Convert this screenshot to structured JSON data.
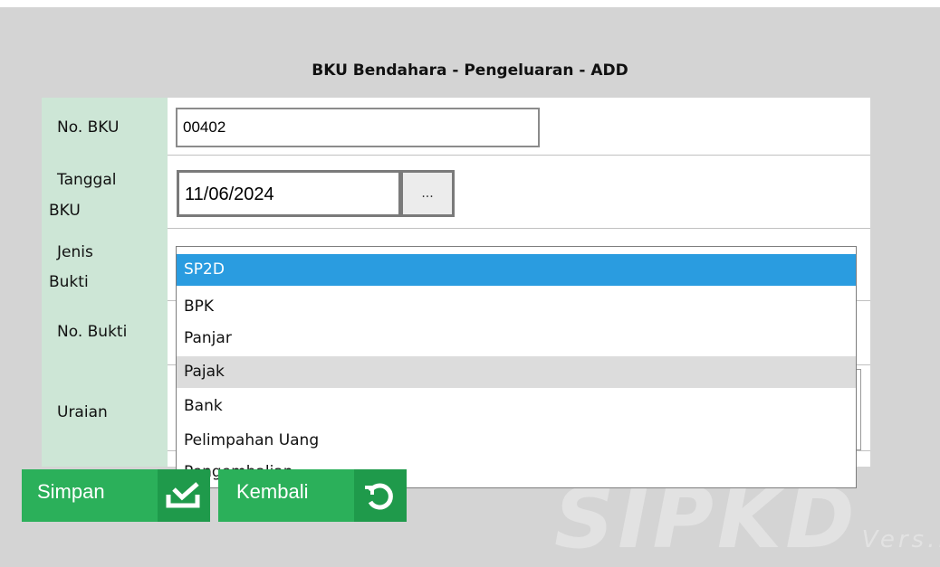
{
  "form": {
    "title": "BKU Bendahara - Pengeluaran - ADD",
    "no_bku_label": "No. BKU",
    "no_bku_value": "00402",
    "tanggal_label_line1": "Tanggal",
    "tanggal_label_line2": "BKU",
    "tanggal_value": "11/06/2024",
    "date_picker_label": "...",
    "jenis_label_line1": "Jenis",
    "jenis_label_line2": "Bukti",
    "no_bukti_label": "No. Bukti",
    "uraian_label": "Uraian"
  },
  "dropdown": {
    "options": [
      "SP2D",
      "BPK",
      "Panjar",
      "Pajak",
      "Bank",
      "Pelimpahan Uang",
      "Pengembalian"
    ],
    "selected": "SP2D",
    "hovered": "Pajak"
  },
  "buttons": {
    "simpan_label": "Simpan",
    "kembali_label": "Kembali"
  },
  "watermark": {
    "logo_text": "SIPKD",
    "sub_text": "Vers.id"
  },
  "colors": {
    "label_column": "#cde6d6",
    "button_green": "#2bb05a",
    "selected_option": "#2a9ce0",
    "hover_option": "#dcdcdc"
  }
}
